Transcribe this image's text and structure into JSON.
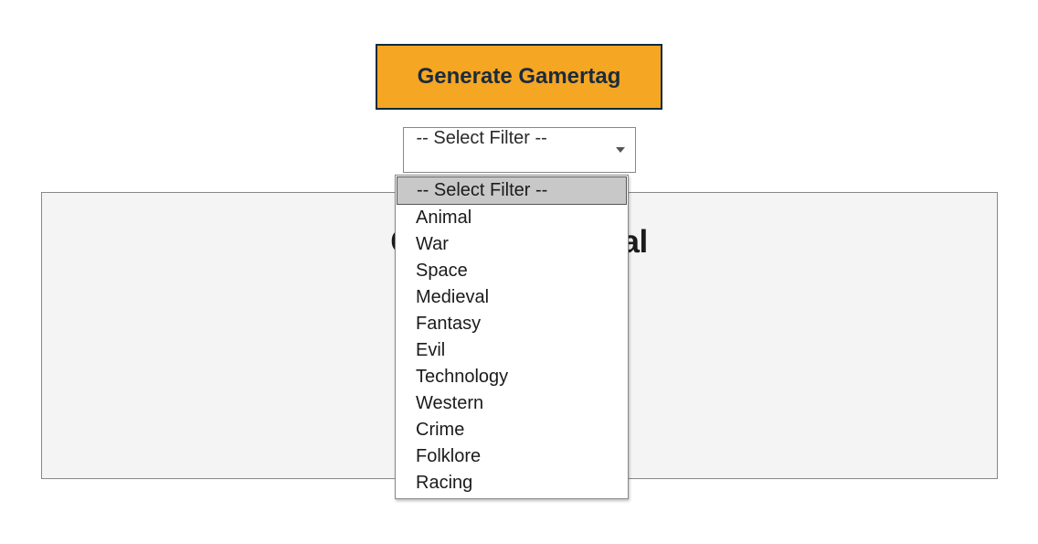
{
  "button": {
    "generate_label": "Generate Gamertag"
  },
  "filter": {
    "placeholder": "-- Select Filter --",
    "options": [
      "-- Select Filter --",
      "Animal",
      "War",
      "Space",
      "Medieval",
      "Fantasy",
      "Evil",
      "Technology",
      "Western",
      "Crime",
      "Folklore",
      "Racing"
    ],
    "selected_index": 0
  },
  "result": {
    "title_left": "C",
    "title_right": "al"
  }
}
